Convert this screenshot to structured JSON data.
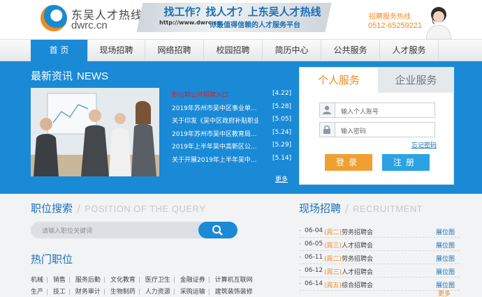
{
  "header": {
    "logo_name": "东吴人才热线",
    "logo_url": "dwrc.cn",
    "banner_title": "找工作？找人才？上东吴人才热线",
    "banner_url": "http://www.dwrc.cn",
    "banner_slogan": "你最值得信赖的人才服务平台",
    "hotline_label": "招聘服务热线",
    "hotline_number": "0512-65259221"
  },
  "nav": {
    "items": [
      {
        "label": "首  页"
      },
      {
        "label": "现场招聘"
      },
      {
        "label": "网络招聘"
      },
      {
        "label": "校园招聘"
      },
      {
        "label": "简历中心"
      },
      {
        "label": "公共服务"
      },
      {
        "label": "人才服务"
      }
    ],
    "active_index": 0
  },
  "news": {
    "title": "最新资讯",
    "title_en": "NEWS",
    "items": [
      {
        "text": "职位聘公开招聘入口",
        "date": "[4.22]"
      },
      {
        "text": "2019年苏州市吴中区事业单...",
        "date": "[5.28]"
      },
      {
        "text": "关于印发《吴中区政府补贴职业...",
        "date": "[5.05]"
      },
      {
        "text": "2019年苏州市吴中区教育局...",
        "date": "[5.24]"
      },
      {
        "text": "2019年上半年吴中高新区公...",
        "date": "[5.29]"
      },
      {
        "text": "关于开展2019年上半年吴中...",
        "date": "[5.14]"
      }
    ],
    "more": "更多"
  },
  "login": {
    "tab_personal": "个人服务",
    "tab_company": "企业服务",
    "account_placeholder": "输入个人账号",
    "password_placeholder": "输入密码",
    "forgot": "忘记密码",
    "login_button": "登录",
    "register_button": "注册"
  },
  "job_search": {
    "title": "职位搜索",
    "title_en": "POSITION OF THE QUERY",
    "placeholder": "请输入职位关键词"
  },
  "hot_jobs": {
    "title": "热门职位",
    "row1": [
      "机械",
      "销售",
      "服务后勤",
      "文化教育",
      "医疗卫生",
      "金融证券",
      "计算机互联网"
    ],
    "row2": [
      "生产",
      "技工",
      "财务审计",
      "生物制药",
      "人力资源",
      "采购运输",
      "建筑装饰装修"
    ]
  },
  "job_fairs": {
    "title": "现场招聘",
    "title_en": "RECRUITMENT",
    "items": [
      {
        "date": "06-04",
        "week": "(周二)",
        "name": "劳务招聘会",
        "link": "展位图"
      },
      {
        "date": "06-05",
        "week": "(周三)",
        "name": "人才招聘会",
        "link": "展位图"
      },
      {
        "date": "06-11",
        "week": "(周二)",
        "name": "劳务招聘会",
        "link": "展位图"
      },
      {
        "date": "06-12",
        "week": "(周三)",
        "name": "人才招聘会",
        "link": "展位图"
      },
      {
        "date": "06-14",
        "week": "(周五)",
        "name": "综合招聘会",
        "link": "展位图"
      }
    ],
    "more": "更多"
  },
  "colors": {
    "brand_blue": "#1a8ad6",
    "accent_orange": "#f08a1c"
  }
}
